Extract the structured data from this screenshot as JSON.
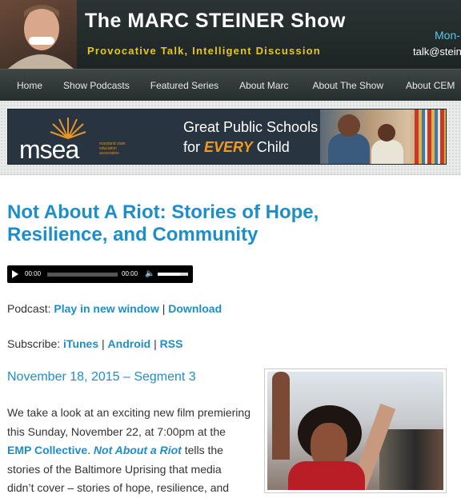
{
  "header": {
    "title": "The MARC STEINER Show",
    "tagline": "Provocative Talk, Intelligent Discussion",
    "hours_partial": "Mon-",
    "email_partial": "talk@stein"
  },
  "nav": {
    "items": [
      "Home",
      "Show Podcasts",
      "Featured Series",
      "About Marc",
      "About The Show",
      "About CEM"
    ]
  },
  "banner": {
    "logo": "msea",
    "logo_small": "maryland state education association",
    "line1": "Great Public Schools",
    "line2_prefix": "for ",
    "line2_emph": "EVERY",
    "line2_suffix": " Child"
  },
  "article": {
    "title": "Not About A Riot: Stories of Hope, Resilience, and Community",
    "player": {
      "current": "00:00",
      "duration": "00:00"
    },
    "podcast_label": "Podcast:",
    "play_link": "Play in new window",
    "download_link": "Download",
    "subscribe_label": "Subscribe:",
    "sub_links": [
      "iTunes",
      "Android",
      "RSS"
    ],
    "separator": "|",
    "date": "November 18, 2015 – Segment 3",
    "body_part1": "We take a look at an exciting new film premiering this Sunday, November 22, at 7:00pm at the ",
    "body_link": "EMP Collective",
    "body_part2": ". ",
    "body_italic": "Not About a Riot",
    "body_part3": " tells the stories of the Baltimore Uprising that media didn’t cover – stories of hope, resilience, and"
  },
  "colors": {
    "link": "#1d8ec8",
    "accent_yellow": "#e5c81b",
    "accent_orange": "#f29a1f"
  }
}
